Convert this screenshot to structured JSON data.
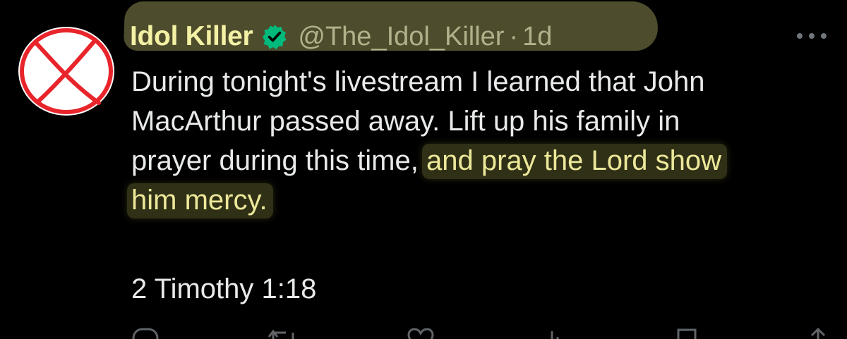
{
  "author": {
    "display_name": "Idol Killer",
    "handle": "@The_Idol_Killer",
    "separator": "·",
    "time": "1d",
    "avatar_icon": "red-x-circle-icon",
    "verified_icon": "verified-badge-icon",
    "verified_color": "#00ba7c"
  },
  "post": {
    "line1": "During tonight's livestream I learned that John",
    "line2": "MacArthur passed away. Lift up his family in",
    "line3_plain": "prayer during this time,",
    "line3_highlight": "and pray the Lord show",
    "line4_highlight": "him mercy.",
    "verse": "2 Timothy 1:18"
  },
  "more_icon": "more-horizontal-icon",
  "actions": {
    "reply_icon": "reply-icon",
    "repost_icon": "repost-icon",
    "like_icon": "heart-icon",
    "views_icon": "views-icon",
    "bookmark_icon": "bookmark-icon",
    "share_icon": "share-icon"
  },
  "colors": {
    "background": "#000000",
    "text": "#e7e9ea",
    "highlight_text": "#ece89a",
    "avatar_x": "#e8252b",
    "muted": "#71767b"
  }
}
